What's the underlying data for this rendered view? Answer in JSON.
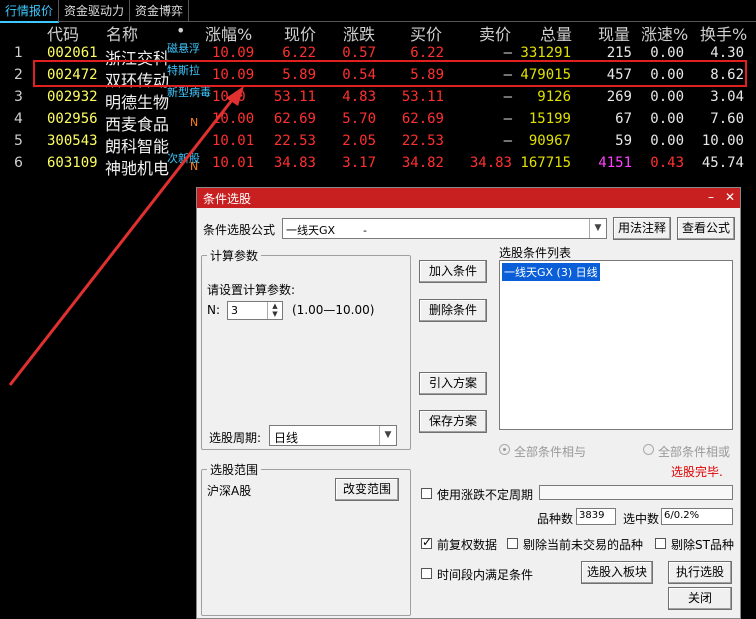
{
  "tabs": [
    "行情报价",
    "资金驱动力",
    "资金博弈"
  ],
  "columns": [
    "代码",
    "名称",
    "•",
    "涨幅%",
    "现价",
    "涨跌",
    "买价",
    "卖价",
    "总量",
    "现量",
    "涨速%",
    "换手%"
  ],
  "rows": [
    {
      "idx": "1",
      "code": "002061",
      "name": "浙江交科",
      "tag": "磁悬浮",
      "n": "",
      "chg_pct": "10.09",
      "price": "6.22",
      "chg": "0.57",
      "bid": "6.22",
      "ask": "–",
      "vol": "331291",
      "cur_vol": "215",
      "speed": "0.00",
      "turnover": "4.30"
    },
    {
      "idx": "2",
      "code": "002472",
      "name": "双环传动",
      "tag": "特斯拉",
      "n": "",
      "chg_pct": "10.09",
      "price": "5.89",
      "chg": "0.54",
      "bid": "5.89",
      "ask": "–",
      "vol": "479015",
      "cur_vol": "457",
      "speed": "0.00",
      "turnover": "8.62"
    },
    {
      "idx": "3",
      "code": "002932",
      "name": "明德生物",
      "tag": "新型病毒",
      "n": "",
      "chg_pct": "10.0",
      "price": "53.11",
      "chg": "4.83",
      "bid": "53.11",
      "ask": "–",
      "vol": "9126",
      "cur_vol": "269",
      "speed": "0.00",
      "turnover": "3.04"
    },
    {
      "idx": "4",
      "code": "002956",
      "name": "西麦食品",
      "tag": "",
      "n": "N",
      "chg_pct": "10.00",
      "price": "62.69",
      "chg": "5.70",
      "bid": "62.69",
      "ask": "–",
      "vol": "15199",
      "cur_vol": "67",
      "speed": "0.00",
      "turnover": "7.60"
    },
    {
      "idx": "5",
      "code": "300543",
      "name": "朗科智能",
      "tag": "",
      "n": "",
      "chg_pct": "10.01",
      "price": "22.53",
      "chg": "2.05",
      "bid": "22.53",
      "ask": "–",
      "vol": "90967",
      "cur_vol": "59",
      "speed": "0.00",
      "turnover": "10.00"
    },
    {
      "idx": "6",
      "code": "603109",
      "name": "神驰机电",
      "tag": "次新股",
      "n": "N",
      "chg_pct": "10.01",
      "price": "34.83",
      "chg": "3.17",
      "bid": "34.82",
      "ask": "34.83",
      "vol": "167715",
      "cur_vol": "4151",
      "speed": "0.43",
      "turnover": "45.74"
    }
  ],
  "dialog": {
    "title": "条件选股",
    "formula_label": "条件选股公式",
    "formula_value": "一线天GX        -",
    "usage_button": "用法注释",
    "view_formula_button": "查看公式",
    "calc_group_title": "计算参数",
    "calc_prompt": "请设置计算参数:",
    "param_name": "N:",
    "param_value": "3",
    "param_range": "(1.00—10.00)",
    "period_label": "选股周期:",
    "period_value": "日线",
    "add_condition": "加入条件",
    "delete_condition": "删除条件",
    "load_scheme": "引入方案",
    "save_scheme": "保存方案",
    "condition_list_label": "选股条件列表",
    "condition_items": [
      "一线天GX (3) 日线"
    ],
    "all_and": "全部条件相与",
    "all_or": "全部条件相或",
    "status": "选股完毕.",
    "range_group_title": "选股范围",
    "range_value": "沪深A股",
    "change_range": "改变范围",
    "use_uncertain_period": "使用涨跌不定周期",
    "stock_count_label": "品种数",
    "stock_count": "3839",
    "selected_label": "选中数",
    "selected_value": "6/0.2%",
    "prev_adjust": "前复权数据",
    "exclude_not_traded": "剔除当前未交易的品种",
    "exclude_st": "剔除ST品种",
    "time_period_condition": "时间段内满足条件",
    "select_to_board": "选股入板块",
    "execute": "执行选股",
    "close": "关闭"
  }
}
